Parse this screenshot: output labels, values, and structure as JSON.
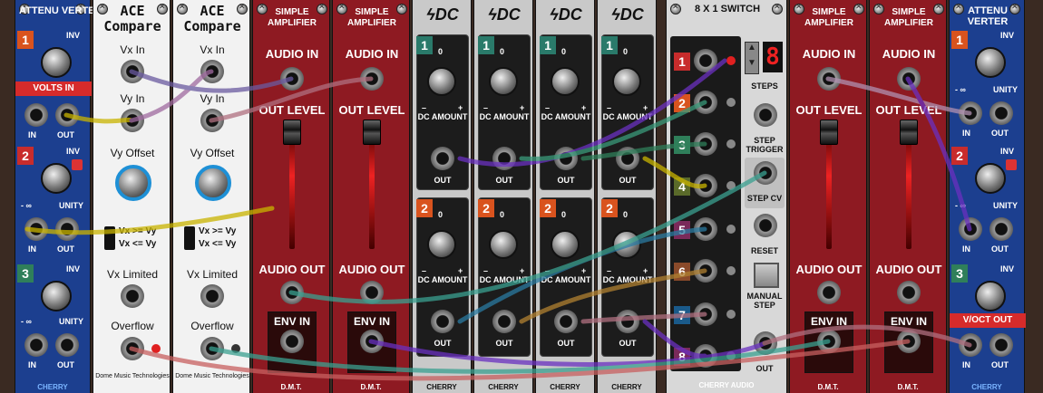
{
  "attenuverter_left": {
    "title": "ATTENU VERTER",
    "inv_label": "INV",
    "volts_in_badge": "VOLTS IN",
    "neg_inf_label": "- ∞",
    "unity_label": "UNITY",
    "in_label": "IN",
    "out_label": "OUT",
    "ch1": "1",
    "ch2": "2",
    "ch3": "3",
    "footer": "CHERRY"
  },
  "ace_compare_1": {
    "title": "ACE Compare",
    "vx_in": "Vx In",
    "vy_in": "Vy In",
    "vy_offset": "Vy Offset",
    "mode_a": "Vx >= Vy",
    "mode_b": "Vx <= Vy",
    "vx_limited": "Vx Limited",
    "overflow": "Overflow",
    "footer": "Dome Music Technologies"
  },
  "ace_compare_2": {
    "title": "ACE Compare",
    "vx_in": "Vx In",
    "vy_in": "Vy In",
    "vy_offset": "Vy Offset",
    "mode_a": "Vx >= Vy",
    "mode_b": "Vx <= Vy",
    "vx_limited": "Vx Limited",
    "overflow": "Overflow",
    "footer": "Dome Music Technologies"
  },
  "simple_amp": {
    "title": "SIMPLE AMPLIFIER",
    "audio_in": "AUDIO IN",
    "out_level": "OUT LEVEL",
    "audio_out": "AUDIO OUT",
    "env_in": "ENV IN",
    "footer": "D.M.T."
  },
  "dc": {
    "title": "DC",
    "zero": "0",
    "minus": "–",
    "plus": "+",
    "dc_amount": "DC AMOUNT",
    "out": "OUT",
    "ch1": "1",
    "ch2": "2",
    "footer": "CHERRY"
  },
  "switch": {
    "title": "8 X 1 SWITCH",
    "steps_label": "STEPS",
    "steps_display": "8",
    "step_trigger": "STEP TRIGGER",
    "step_cv": "STEP CV",
    "reset": "RESET",
    "manual_step": "MANUAL STEP",
    "out": "OUT",
    "channels": [
      "1",
      "2",
      "3",
      "4",
      "5",
      "6",
      "7",
      "8"
    ],
    "footer": "CHERRY AUDIO"
  },
  "attenuverter_right": {
    "title": "ATTENU VERTER",
    "inv_label": "INV",
    "voct_badge": "V/OCT OUT",
    "neg_inf_label": "- ∞",
    "unity_label": "UNITY",
    "in_label": "IN",
    "out_label": "OUT",
    "ch1": "1",
    "ch2": "2",
    "ch3": "3",
    "footer": "CHERRY"
  },
  "colors": {
    "attenuverter_bg": "#1c3f8f",
    "amp_bg": "#8e1a22",
    "dc_bg": "#c9c9c9",
    "switch_bg": "#d8d8d8",
    "ch_orange": "#d9531e",
    "ch_red": "#c82c2c",
    "ch_green": "#2f7f5a",
    "ch_teal": "#2a7a6a",
    "ch_olive": "#5a6a2a",
    "ch_purple": "#7a2a5a",
    "ch_brown": "#8a4a2a",
    "ch_blue": "#1a5a8a"
  }
}
